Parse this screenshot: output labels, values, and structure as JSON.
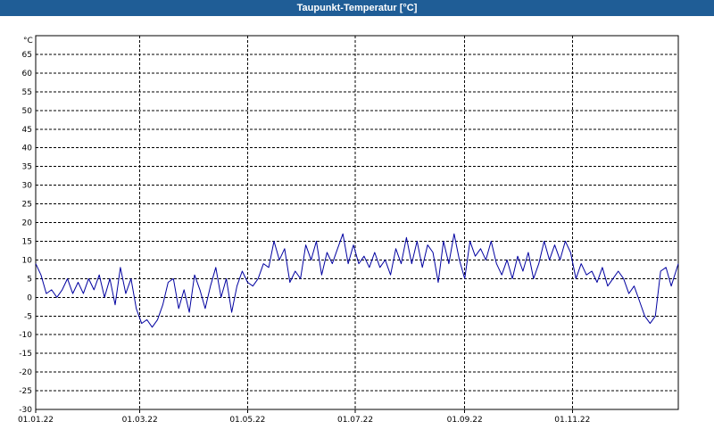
{
  "window": {
    "title": "Taupunkt-Temperatur [°C]"
  },
  "colors": {
    "titlebar": "#1f5d96",
    "line": "#0000a0",
    "grid": "#000000",
    "background": "#ffffff"
  },
  "chart_data": {
    "type": "line",
    "title": "Taupunkt-Temperatur [°C]",
    "ylabel": "°C",
    "ylim": [
      -30,
      70
    ],
    "yticks": [
      65,
      60,
      55,
      50,
      45,
      40,
      35,
      30,
      25,
      20,
      15,
      10,
      5,
      0,
      -5,
      -10,
      -15,
      -20,
      -25,
      -30
    ],
    "xlim": [
      "2022-01-01",
      "2022-12-31"
    ],
    "xticks": [
      {
        "date": "2022-01-01",
        "label": "01.01.22"
      },
      {
        "date": "2022-03-01",
        "label": "01.03.22"
      },
      {
        "date": "2022-05-01",
        "label": "01.05.22"
      },
      {
        "date": "2022-07-01",
        "label": "01.07.22"
      },
      {
        "date": "2022-09-01",
        "label": "01.09.22"
      },
      {
        "date": "2022-11-01",
        "label": "01.11.22"
      }
    ],
    "grid": true,
    "series": [
      {
        "values_by_date": [
          [
            "2022-01-01",
            9
          ],
          [
            "2022-01-04",
            6
          ],
          [
            "2022-01-07",
            1
          ],
          [
            "2022-01-10",
            2
          ],
          [
            "2022-01-13",
            0
          ],
          [
            "2022-01-16",
            2
          ],
          [
            "2022-01-19",
            5
          ],
          [
            "2022-01-22",
            1
          ],
          [
            "2022-01-25",
            4
          ],
          [
            "2022-01-28",
            1
          ],
          [
            "2022-01-31",
            5
          ],
          [
            "2022-02-03",
            2
          ],
          [
            "2022-02-06",
            6
          ],
          [
            "2022-02-09",
            0
          ],
          [
            "2022-02-12",
            5
          ],
          [
            "2022-02-15",
            -2
          ],
          [
            "2022-02-18",
            8
          ],
          [
            "2022-02-21",
            1
          ],
          [
            "2022-02-24",
            5
          ],
          [
            "2022-02-27",
            -3
          ],
          [
            "2022-03-02",
            -7
          ],
          [
            "2022-03-05",
            -6
          ],
          [
            "2022-03-08",
            -8
          ],
          [
            "2022-03-11",
            -6
          ],
          [
            "2022-03-14",
            -2
          ],
          [
            "2022-03-17",
            4
          ],
          [
            "2022-03-20",
            5
          ],
          [
            "2022-03-23",
            -3
          ],
          [
            "2022-03-26",
            2
          ],
          [
            "2022-03-29",
            -4
          ],
          [
            "2022-04-01",
            6
          ],
          [
            "2022-04-04",
            2
          ],
          [
            "2022-04-07",
            -3
          ],
          [
            "2022-04-10",
            3
          ],
          [
            "2022-04-13",
            8
          ],
          [
            "2022-04-16",
            0
          ],
          [
            "2022-04-19",
            5
          ],
          [
            "2022-04-22",
            -4
          ],
          [
            "2022-04-25",
            3
          ],
          [
            "2022-04-28",
            7
          ],
          [
            "2022-05-01",
            4
          ],
          [
            "2022-05-04",
            3
          ],
          [
            "2022-05-07",
            5
          ],
          [
            "2022-05-10",
            9
          ],
          [
            "2022-05-13",
            8
          ],
          [
            "2022-05-16",
            15
          ],
          [
            "2022-05-19",
            10
          ],
          [
            "2022-05-22",
            13
          ],
          [
            "2022-05-25",
            4
          ],
          [
            "2022-05-28",
            7
          ],
          [
            "2022-05-31",
            5
          ],
          [
            "2022-06-03",
            14
          ],
          [
            "2022-06-06",
            10
          ],
          [
            "2022-06-09",
            15
          ],
          [
            "2022-06-12",
            6
          ],
          [
            "2022-06-15",
            12
          ],
          [
            "2022-06-18",
            9
          ],
          [
            "2022-06-21",
            13
          ],
          [
            "2022-06-24",
            17
          ],
          [
            "2022-06-27",
            9
          ],
          [
            "2022-06-30",
            14
          ],
          [
            "2022-07-03",
            9
          ],
          [
            "2022-07-06",
            11
          ],
          [
            "2022-07-09",
            8
          ],
          [
            "2022-07-12",
            12
          ],
          [
            "2022-07-15",
            8
          ],
          [
            "2022-07-18",
            10
          ],
          [
            "2022-07-21",
            6
          ],
          [
            "2022-07-24",
            13
          ],
          [
            "2022-07-27",
            9
          ],
          [
            "2022-07-30",
            16
          ],
          [
            "2022-08-02",
            9
          ],
          [
            "2022-08-05",
            15
          ],
          [
            "2022-08-08",
            8
          ],
          [
            "2022-08-11",
            14
          ],
          [
            "2022-08-14",
            12
          ],
          [
            "2022-08-17",
            4
          ],
          [
            "2022-08-20",
            15
          ],
          [
            "2022-08-23",
            9
          ],
          [
            "2022-08-26",
            17
          ],
          [
            "2022-08-29",
            10
          ],
          [
            "2022-09-01",
            5
          ],
          [
            "2022-09-04",
            15
          ],
          [
            "2022-09-07",
            11
          ],
          [
            "2022-09-10",
            13
          ],
          [
            "2022-09-13",
            10
          ],
          [
            "2022-09-16",
            15
          ],
          [
            "2022-09-19",
            9
          ],
          [
            "2022-09-22",
            6
          ],
          [
            "2022-09-25",
            10
          ],
          [
            "2022-09-28",
            5
          ],
          [
            "2022-10-01",
            11
          ],
          [
            "2022-10-04",
            7
          ],
          [
            "2022-10-07",
            12
          ],
          [
            "2022-10-10",
            5
          ],
          [
            "2022-10-13",
            9
          ],
          [
            "2022-10-16",
            15
          ],
          [
            "2022-10-19",
            10
          ],
          [
            "2022-10-22",
            14
          ],
          [
            "2022-10-25",
            10
          ],
          [
            "2022-10-28",
            15
          ],
          [
            "2022-10-31",
            12
          ],
          [
            "2022-11-03",
            5
          ],
          [
            "2022-11-06",
            9
          ],
          [
            "2022-11-09",
            6
          ],
          [
            "2022-11-12",
            7
          ],
          [
            "2022-11-15",
            4
          ],
          [
            "2022-11-18",
            8
          ],
          [
            "2022-11-21",
            3
          ],
          [
            "2022-11-24",
            5
          ],
          [
            "2022-11-27",
            7
          ],
          [
            "2022-11-30",
            5
          ],
          [
            "2022-12-03",
            1
          ],
          [
            "2022-12-06",
            3
          ],
          [
            "2022-12-09",
            -1
          ],
          [
            "2022-12-12",
            -5
          ],
          [
            "2022-12-15",
            -7
          ],
          [
            "2022-12-18",
            -5
          ],
          [
            "2022-12-21",
            7
          ],
          [
            "2022-12-24",
            8
          ],
          [
            "2022-12-27",
            3
          ],
          [
            "2022-12-31",
            9
          ]
        ]
      }
    ]
  }
}
